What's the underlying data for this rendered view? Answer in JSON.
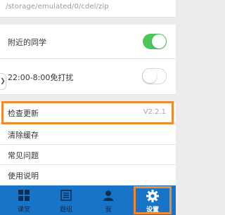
{
  "path": {
    "text": "/storage/emulated/0/cdel/zip"
  },
  "settings": {
    "nearby_label": "附近的同学",
    "nearby_on": true,
    "dnd_label": "22:00-8:00免打扰",
    "dnd_on": false,
    "check_update_label": "检查更新",
    "version": "V2.2.1",
    "clear_cache_label": "清除缓存",
    "faq_label": "常见问题",
    "help_label": "使用说明"
  },
  "tabs": [
    {
      "label": "课堂",
      "icon": "grid-icon"
    },
    {
      "label": "题组",
      "icon": "document-icon"
    },
    {
      "label": "我",
      "icon": "person-icon"
    },
    {
      "label": "设置",
      "icon": "gear-icon",
      "active": true
    }
  ],
  "colors": {
    "accent": "#1874c6",
    "toggle_on": "#4cc85a",
    "highlight": "#f08a2e"
  }
}
